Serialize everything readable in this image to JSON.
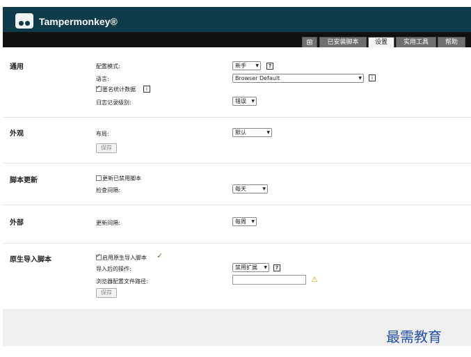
{
  "app": {
    "brand": "Tampermonkey®"
  },
  "tabs": {
    "plus": "⊞",
    "installed": "已安装脚本",
    "settings": "设置",
    "utilities": "实用工具",
    "help": "帮助"
  },
  "general": {
    "title": "通用",
    "config_mode_label": "配置模式:",
    "config_mode_value": "新手",
    "language_label": "语言:",
    "language_value": "Browser Default",
    "anon_stats_label": "匿名统计数据",
    "log_level_label": "日志记录级别:",
    "log_level_value": "错误"
  },
  "appearance": {
    "title": "外观",
    "layout_label": "布局:",
    "layout_value": "默认",
    "save": "保存"
  },
  "script_update": {
    "title": "脚本更新",
    "update_disabled_label": "更新已禁用脚本",
    "check_interval_label": "检查间隔:",
    "check_interval_value": "每天"
  },
  "external": {
    "title": "外部",
    "update_interval_label": "更新间隔:",
    "update_interval_value": "每周"
  },
  "native_import": {
    "title": "原生导入脚本",
    "enable_label": "启用原生导入脚本",
    "after_import_label": "导入后的操作:",
    "after_import_value": "禁用扩展",
    "browser_profile_label": "浏览器配置文件路径:",
    "save": "保存"
  },
  "watermark": "最需教育",
  "colors": {
    "header": "#0d3b4a",
    "tabbar": "#111111",
    "tab": "#6f6f6f"
  }
}
